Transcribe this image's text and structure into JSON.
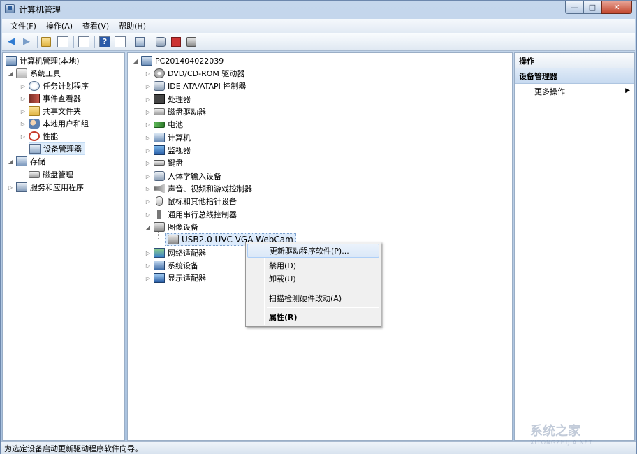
{
  "window": {
    "title": "计算机管理"
  },
  "menubar": [
    "文件(F)",
    "操作(A)",
    "查看(V)",
    "帮助(H)"
  ],
  "toolbar": {
    "icons": [
      "back-icon",
      "forward-icon",
      "up-folder-icon",
      "show-hide-tree-icon",
      "properties-icon",
      "help-icon",
      "show-action-pane-icon",
      "scan-hardware-icon",
      "update-driver-icon",
      "uninstall-icon",
      "disable-icon"
    ],
    "help_glyph": "?"
  },
  "left_tree": {
    "root": "计算机管理(本地)",
    "system_tools": "系统工具",
    "task_scheduler": "任务计划程序",
    "event_viewer": "事件查看器",
    "shared_folders": "共享文件夹",
    "local_users": "本地用户和组",
    "performance": "性能",
    "device_manager": "设备管理器",
    "storage": "存储",
    "disk_management": "磁盘管理",
    "services_apps": "服务和应用程序"
  },
  "device_tree": {
    "computer_name": "PC201404022039",
    "categories": [
      "DVD/CD-ROM 驱动器",
      "IDE ATA/ATAPI 控制器",
      "处理器",
      "磁盘驱动器",
      "电池",
      "计算机",
      "监视器",
      "键盘",
      "人体学输入设备",
      "声音、视频和游戏控制器",
      "鼠标和其他指针设备",
      "通用串行总线控制器",
      "图像设备"
    ],
    "selected_device": "USB2.0 UVC VGA WebCam",
    "after": [
      "网络适配器",
      "系统设备",
      "显示适配器"
    ]
  },
  "context_menu": {
    "update_driver": "更新驱动程序软件(P)...",
    "disable": "禁用(D)",
    "uninstall": "卸载(U)",
    "scan": "扫描检测硬件改动(A)",
    "properties": "属性(R)"
  },
  "actions": {
    "header": "操作",
    "section": "设备管理器",
    "more": "更多操作"
  },
  "status_text": "为选定设备启动更新驱动程序软件向导。",
  "watermark": {
    "main": "系统之家",
    "sub": "XITONGZHIJIA.NET"
  }
}
